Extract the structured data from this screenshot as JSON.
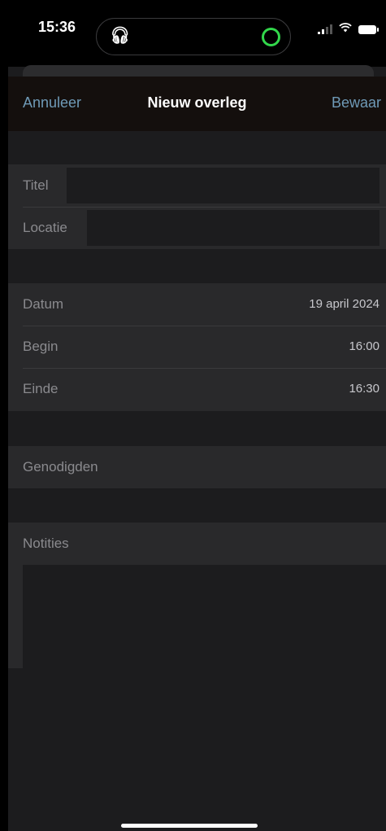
{
  "status_bar": {
    "time": "15:36",
    "island_icon": "earbuds-icon",
    "icons": [
      "signal-icon",
      "wifi-icon",
      "battery-icon"
    ]
  },
  "navbar": {
    "cancel_label": "Annuleer",
    "title": "Nieuw overleg",
    "save_label": "Bewaar"
  },
  "form": {
    "title_label": "Titel",
    "title_value": "",
    "location_label": "Locatie",
    "location_value": "",
    "date_label": "Datum",
    "date_value": "19 april 2024",
    "start_label": "Begin",
    "start_value": "16:00",
    "end_label": "Einde",
    "end_value": "16:30",
    "invitees_label": "Genodigden",
    "notes_label": "Notities",
    "notes_value": ""
  },
  "colors": {
    "accent": "#6f9ab7",
    "background": "#1c1c1e",
    "group": "#29292b",
    "navbar": "#140f0d",
    "status_green": "#32d74b"
  }
}
